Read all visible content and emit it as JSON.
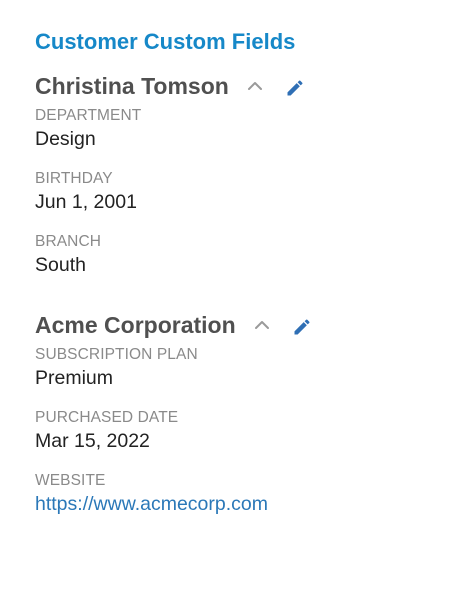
{
  "panel": {
    "title": "Customer Custom Fields"
  },
  "sections": [
    {
      "title": "Christina Tomson",
      "fields": [
        {
          "label": "DEPARTMENT",
          "value": "Design"
        },
        {
          "label": "BIRTHDAY",
          "value": "Jun 1, 2001"
        },
        {
          "label": "BRANCH",
          "value": "South"
        }
      ]
    },
    {
      "title": "Acme Corporation",
      "fields": [
        {
          "label": "SUBSCRIPTION PLAN",
          "value": "Premium"
        },
        {
          "label": "PURCHASED DATE",
          "value": "Mar 15, 2022"
        },
        {
          "label": "WEBSITE",
          "value": "https://www.acmecorp.com"
        }
      ]
    }
  ],
  "icons": {
    "collapse": "chevron-up-icon",
    "edit": "pencil-icon"
  },
  "colors": {
    "title_accent": "#1688c8",
    "link": "#2b78b8",
    "label": "#8a8a8a",
    "section_heading": "#505050",
    "icon_chevron": "#9a9a9a",
    "icon_pencil": "#2f6fb5"
  }
}
